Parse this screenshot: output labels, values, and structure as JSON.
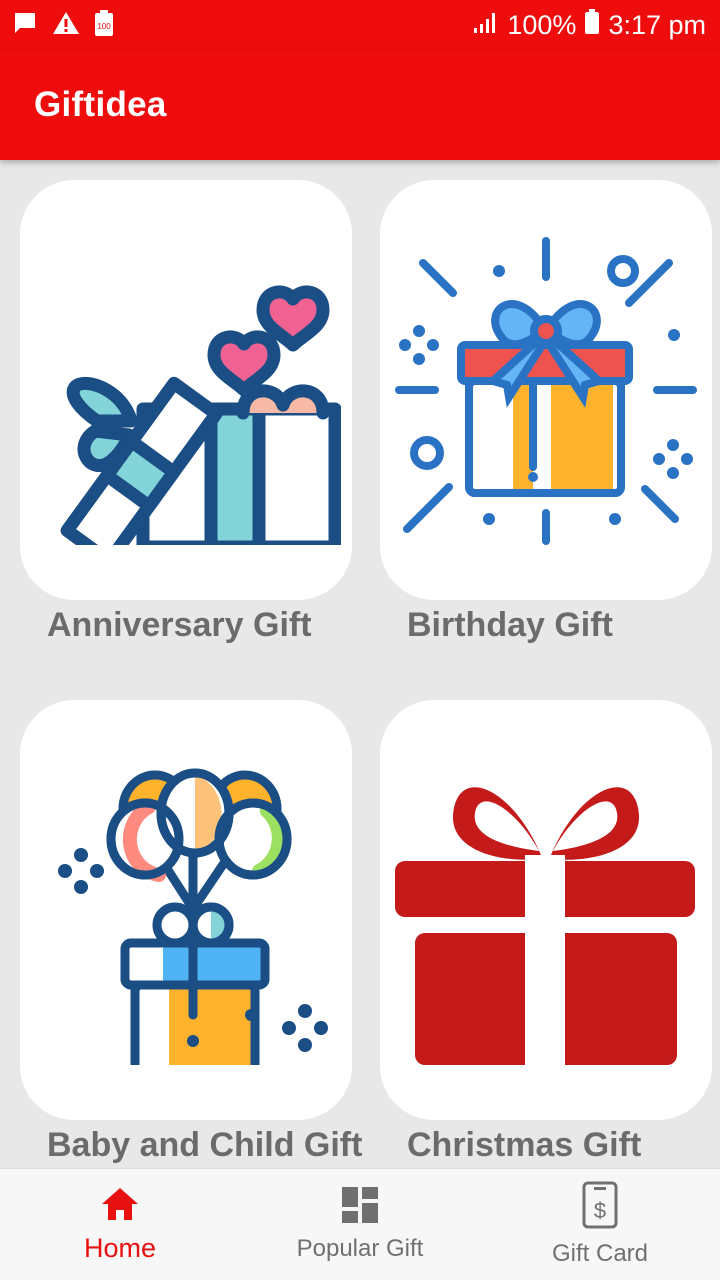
{
  "status_bar": {
    "battery_percent": "100%",
    "time": "3:17 pm",
    "icons": [
      "message-icon",
      "warning-icon",
      "battery-saver-icon",
      "signal-icon",
      "battery-icon"
    ]
  },
  "app_bar": {
    "title": "Giftidea"
  },
  "categories": [
    {
      "label": "Anniversary Gift",
      "icon": "anniversary-gift-icon"
    },
    {
      "label": "Birthday Gift",
      "icon": "birthday-gift-icon"
    },
    {
      "label": "Baby and Child Gift",
      "icon": "baby-gift-icon"
    },
    {
      "label": "Christmas Gift",
      "icon": "christmas-gift-icon"
    }
  ],
  "bottom_nav": {
    "items": [
      {
        "label": "Home",
        "icon": "home-icon",
        "active": true
      },
      {
        "label": "Popular Gift",
        "icon": "dashboard-icon",
        "active": false
      },
      {
        "label": "Gift Card",
        "icon": "gift-card-icon",
        "active": false
      }
    ]
  },
  "colors": {
    "primary": "#ee0c0c",
    "background": "#e8e8e8",
    "label_gray": "#6b6b6b",
    "nav_active": "#e81010",
    "icon_navy": "#1a4e85",
    "icon_blue": "#2a73c4",
    "christmas_red": "#c41a1a"
  }
}
